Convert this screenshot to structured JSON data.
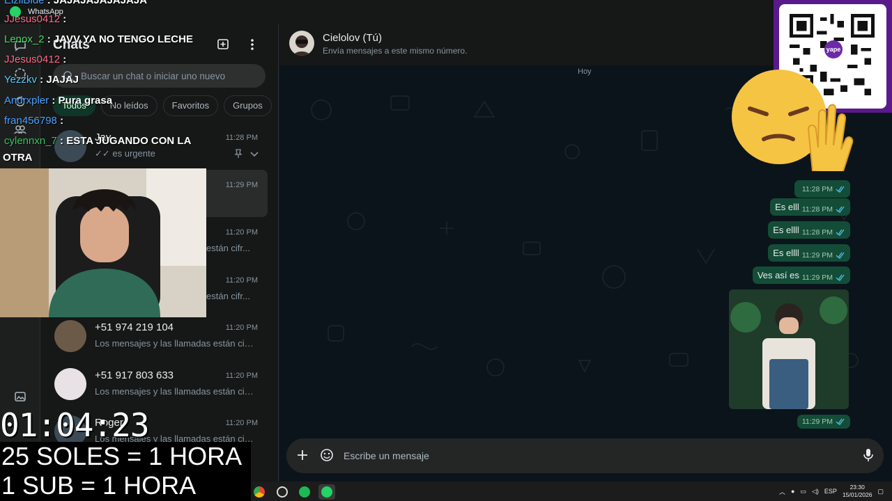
{
  "window": {
    "app_name": "WhatsApp"
  },
  "rail": {
    "icons": [
      "chats-icon",
      "status-icon",
      "channels-icon",
      "communities-icon",
      "media-icon"
    ]
  },
  "chatlist": {
    "title": "Chats",
    "search_placeholder": "Buscar un chat o iniciar uno nuevo",
    "filters": [
      "Todos",
      "No leídos",
      "Favoritos",
      "Grupos"
    ],
    "rows": [
      {
        "name": "Jav",
        "preview": "es urgente",
        "time": "11:28 PM"
      },
      {
        "name": "",
        "preview": "",
        "time": "11:29 PM"
      },
      {
        "name": "",
        "preview": "están cifr...",
        "time": "11:20 PM"
      },
      {
        "name": "",
        "preview": "están cifr...",
        "time": "11:20 PM"
      },
      {
        "name": "+51 974 219 104",
        "preview": "Los mensajes y las llamadas están cifr...",
        "time": "11:20 PM"
      },
      {
        "name": "+51 917 803 633",
        "preview": "Los mensajes y las llamadas están cifr...",
        "time": "11:20 PM"
      },
      {
        "name": "Roger",
        "preview": "Los mensajes y las llamadas están cifr...",
        "time": "11:20 PM"
      }
    ]
  },
  "conversation": {
    "name": "Cielolov (Tú)",
    "subtitle": "Envía mensajes a este mismo número.",
    "day": "Hoy",
    "messages": [
      {
        "text": "",
        "time": "11:28 PM"
      },
      {
        "text": "Es elll",
        "time": "11:28 PM"
      },
      {
        "text": "Es ellll",
        "time": "11:28 PM"
      },
      {
        "text": "Es ellll",
        "time": "11:29 PM"
      },
      {
        "text": "Ves así es",
        "time": "11:29 PM"
      }
    ],
    "image_message_time": "11:29 PM",
    "composer_placeholder": "Escribe un mensaje"
  },
  "taskbar": {
    "apps": [
      "chrome-icon",
      "obs-icon",
      "spotify-icon",
      "whatsapp-icon"
    ],
    "lang": "ESP",
    "time": "23:30",
    "date": "15/01/2026"
  },
  "overlay": {
    "chat": [
      {
        "user": "EizllBlde",
        "text": "JAJAJAJAJAJAJA",
        "color": "#4aa3ff"
      },
      {
        "user": "JJesus0412",
        "text": "",
        "color": "#ff6a8a"
      },
      {
        "user": "Lenox_2",
        "text": "JAVV YA NO TENGO LECHE",
        "color": "#4cd964"
      },
      {
        "user": "JJesus0412",
        "text": "",
        "color": "#ff6a8a"
      },
      {
        "user": "Yezzkv",
        "text": "JAJAJ",
        "color": "#5ac8fa"
      },
      {
        "user": "Andrxpler",
        "text": "Pura grasa",
        "color": "#4aa3ff"
      },
      {
        "user": "fran456798",
        "text": "",
        "color": "#4aa3ff"
      },
      {
        "user": "cylennxn_7",
        "text": "ESTA JUGANDO CON LA",
        "color": "#34c759"
      }
    ],
    "chat_wrap": "OTRA",
    "qr_label": "yape",
    "timer": "01:04:23",
    "promo_1": "25 SOLES = 1 HORA",
    "promo_2": "1 SUB = 1 HORA"
  },
  "colors": {
    "bubble_out": "#144d37",
    "accent": "#25d366",
    "panel": "#161717"
  }
}
